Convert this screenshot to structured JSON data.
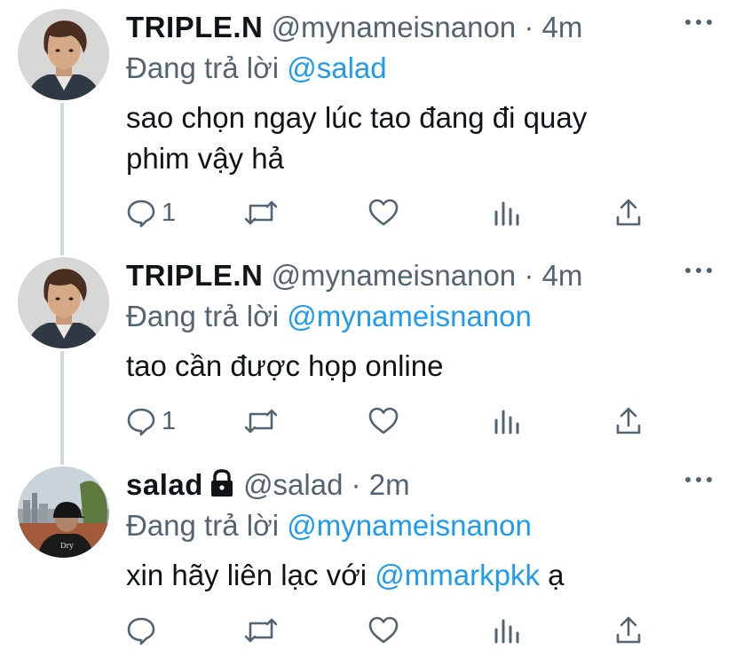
{
  "tweets": [
    {
      "name": "TRIPLE.N",
      "handle": "@mynameisnanon",
      "separator": "·",
      "time": "4m",
      "replying_prefix": "Đang trả lời",
      "replying_to": "@salad",
      "text_lines": [
        "sao chọn ngay lúc tao đang đi quay",
        "phim vậy hả"
      ],
      "reply_count": "1",
      "avatar": "avatar-nanon"
    },
    {
      "name": "TRIPLE.N",
      "handle": "@mynameisnanon",
      "separator": "·",
      "time": "4m",
      "replying_prefix": "Đang trả lời",
      "replying_to": "@mynameisnanon",
      "text_lines": [
        "tao cần được họp online"
      ],
      "reply_count": "1",
      "avatar": "avatar-nanon"
    },
    {
      "name": "salad",
      "locked": true,
      "handle": "@salad",
      "separator": "·",
      "time": "2m",
      "replying_prefix": "Đang trả lời",
      "replying_to": "@mynameisnanon",
      "text_before": "xin hãy liên lạc với ",
      "text_mention": "@mmarkpkk",
      "text_after": " ạ",
      "reply_count": "",
      "avatar": "avatar-salad"
    }
  ],
  "colors": {
    "accent": "#1d9bf0",
    "secondary": "#536471",
    "text": "#0f1419",
    "thread_line": "#cfd9de"
  },
  "icons": [
    "reply-icon",
    "retweet-icon",
    "like-icon",
    "analytics-icon",
    "share-icon",
    "more-icon",
    "lock-icon"
  ]
}
